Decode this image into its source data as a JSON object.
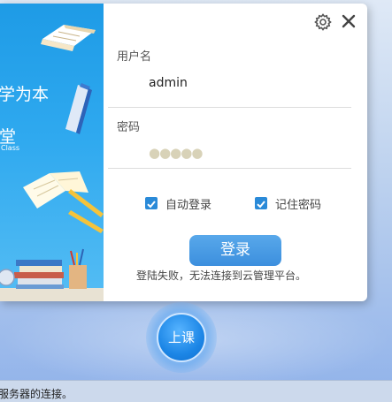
{
  "promo": {
    "line1": "学为本",
    "line2": "堂",
    "line3": "Class"
  },
  "dialog": {
    "settings_icon": "gear-icon",
    "close_icon": "close-icon",
    "username_label": "用户名",
    "username_value": "admin",
    "password_label": "密码",
    "password_value": "●●●●●",
    "auto_login_label": "自动登录",
    "auto_login_checked": true,
    "remember_password_label": "记住密码",
    "remember_password_checked": true,
    "login_button": "登录",
    "error_message": "登陆失败，无法连接到云管理平台。"
  },
  "floating": {
    "class_button": "上课"
  },
  "statusbar": {
    "text": "服务器的连接。"
  },
  "colors": {
    "accent": "#3c8fde",
    "promo_blue": "#2fa9ef",
    "checkbox": "#2a8ad8"
  }
}
